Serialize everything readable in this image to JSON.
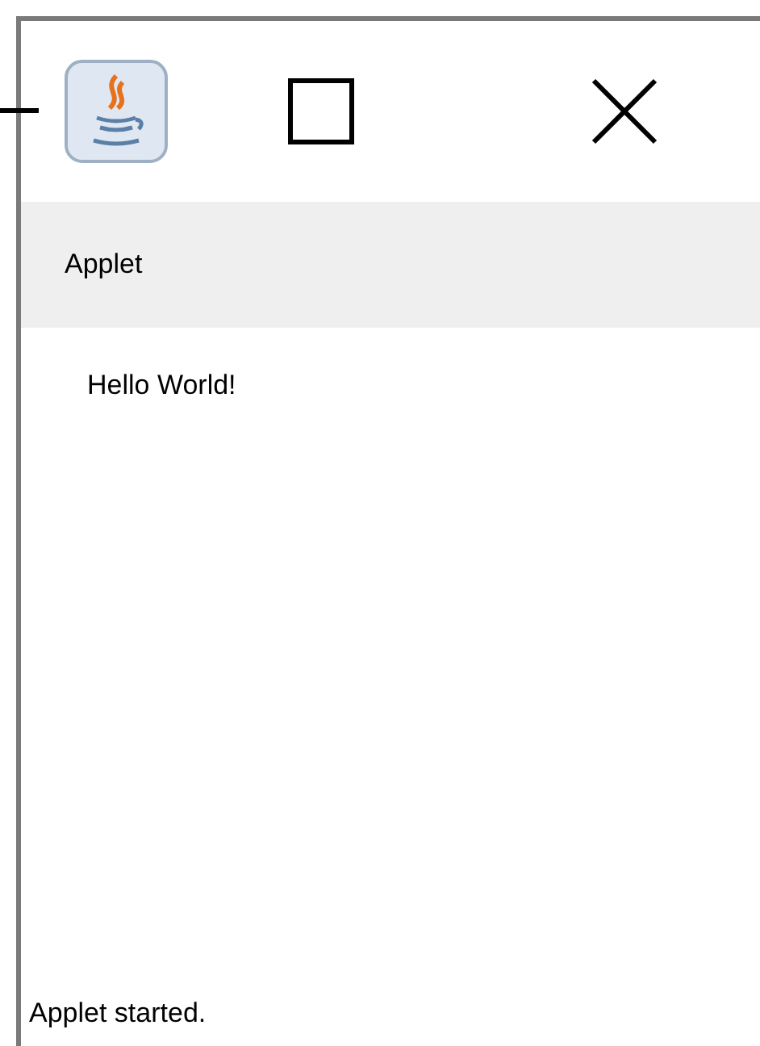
{
  "window": {
    "title_bar": {
      "buttons": [
        {
          "kind": "minimize"
        },
        {
          "kind": "maximize"
        },
        {
          "kind": "close"
        }
      ]
    }
  },
  "menu_bar": {
    "items": [
      {
        "label": "Applet"
      }
    ]
  },
  "content": {
    "text": "Hello World!"
  },
  "status_bar": {
    "text": "Applet started."
  }
}
